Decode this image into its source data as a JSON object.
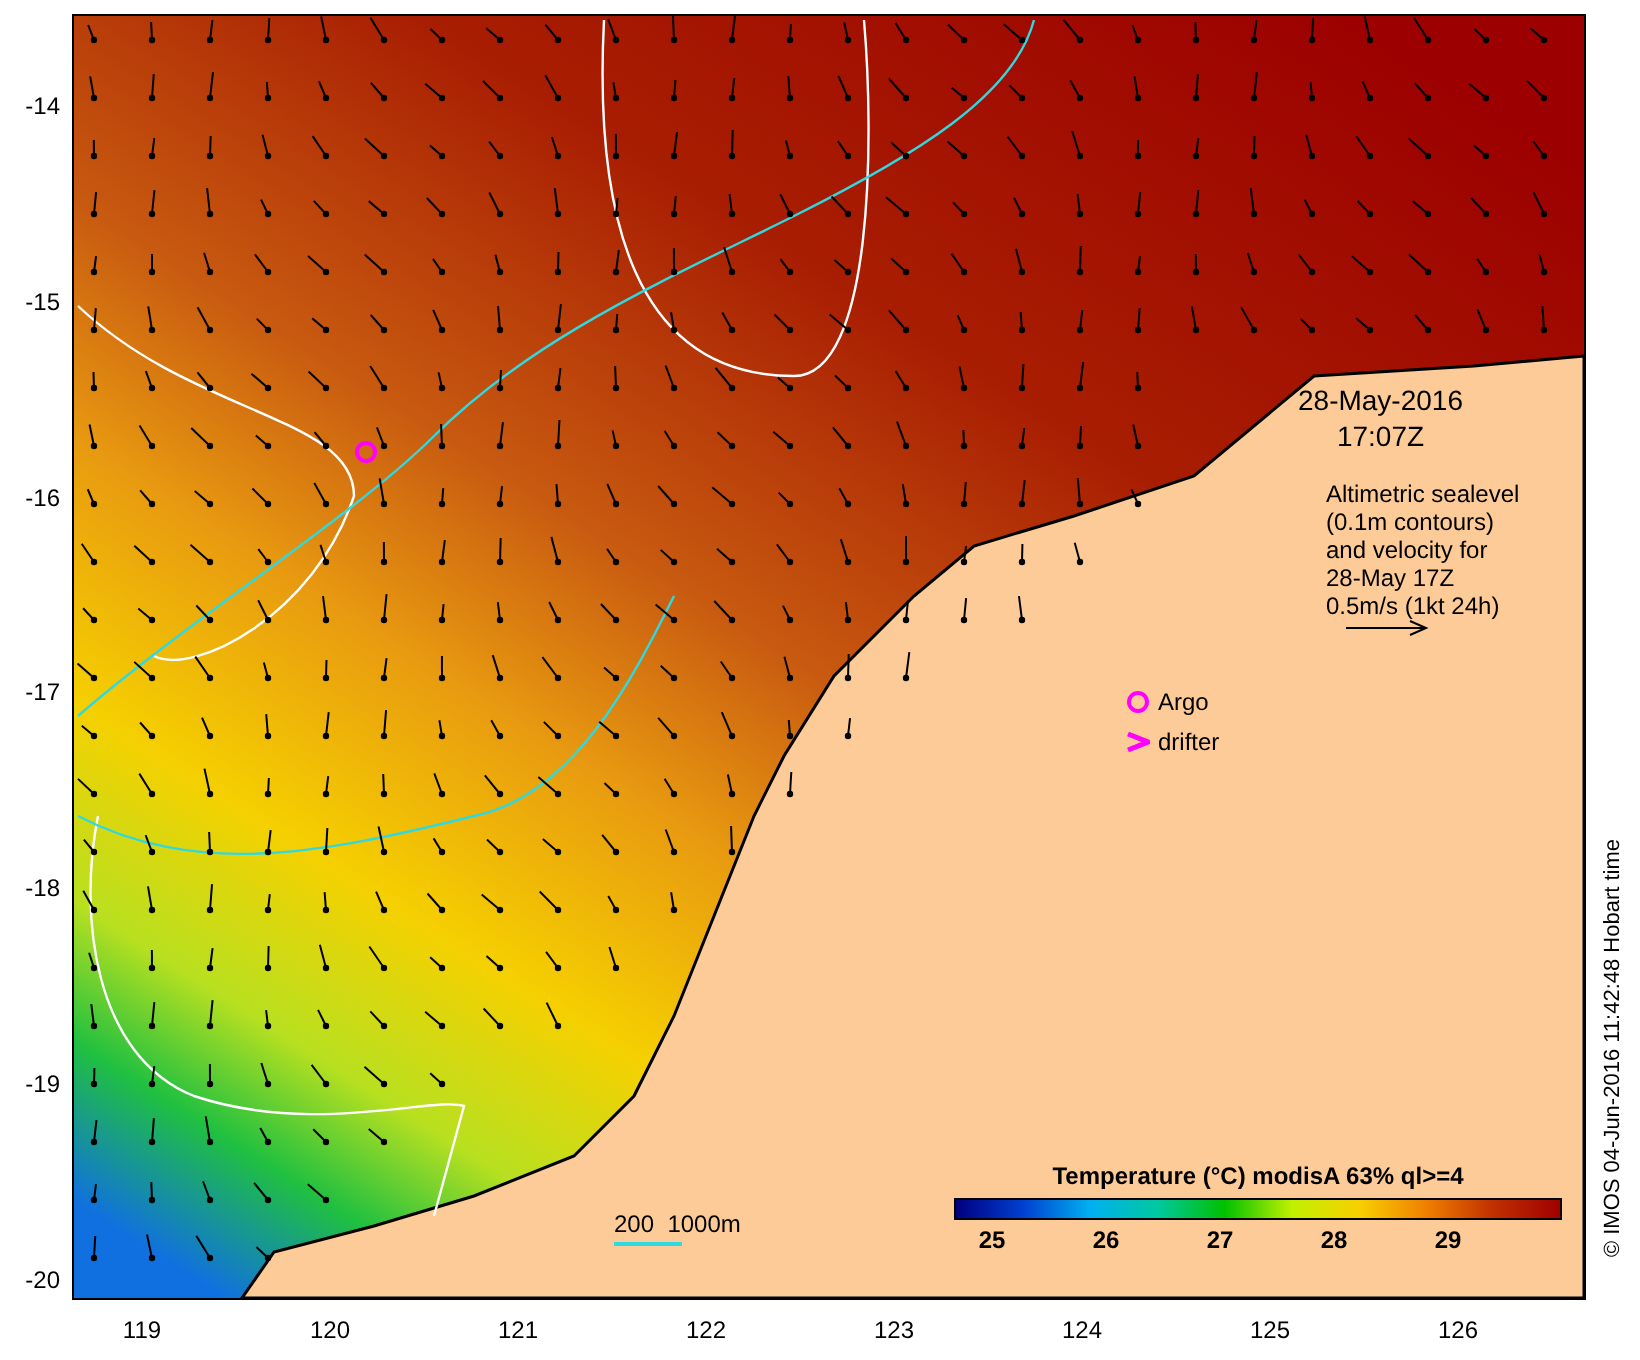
{
  "map": {
    "y_ticks": [
      "-14",
      "-15",
      "-16",
      "-17",
      "-18",
      "-19",
      "-20"
    ],
    "x_ticks": [
      "119",
      "120",
      "121",
      "122",
      "123",
      "124",
      "125",
      "126"
    ],
    "timestamp": {
      "date": "28-May-2016",
      "time": "17:07Z"
    },
    "overlay_note": "Altimetric sealevel\n(0.1m contours)\nand velocity for\n28-May 17Z\n0.5m/s (1kt 24h)",
    "legend": [
      {
        "kind": "circle",
        "label": "Argo"
      },
      {
        "kind": "chevron",
        "label": "drifter"
      }
    ],
    "depth_scale": {
      "label": "200  1000m"
    },
    "colorbar": {
      "title": "Temperature (°C) modisA 63% ql>=4",
      "ticks": [
        "25",
        "26",
        "27",
        "28",
        "29"
      ]
    }
  },
  "credit": "© IMOS 04-Jun-2016 11:42:48 Hobart time"
}
